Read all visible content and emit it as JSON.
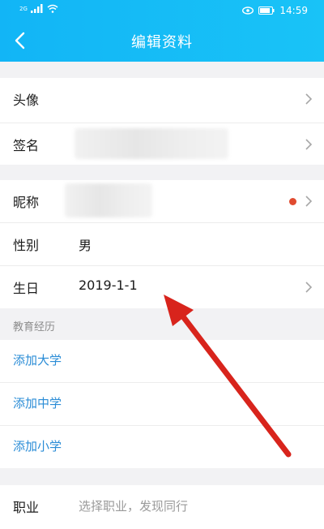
{
  "status_bar": {
    "network": "2G",
    "time": "14:59"
  },
  "nav": {
    "title": "编辑资料"
  },
  "section1": {
    "rows": [
      {
        "label": "头像"
      },
      {
        "label": "签名"
      }
    ]
  },
  "section2": {
    "rows": [
      {
        "label": "昵称"
      },
      {
        "label": "性别",
        "value": "男"
      },
      {
        "label": "生日",
        "value": "2019-1-1"
      }
    ]
  },
  "education": {
    "group_title": "教育经历",
    "links": [
      {
        "label": "添加大学"
      },
      {
        "label": "添加中学"
      },
      {
        "label": "添加小学"
      }
    ]
  },
  "job": {
    "label": "职业",
    "placeholder": "选择职业，发现同行"
  },
  "colors": {
    "header": "#19c3f7",
    "link": "#2a8cd6",
    "badge": "#e04b2f",
    "annotation_arrow": "#d8241c"
  }
}
